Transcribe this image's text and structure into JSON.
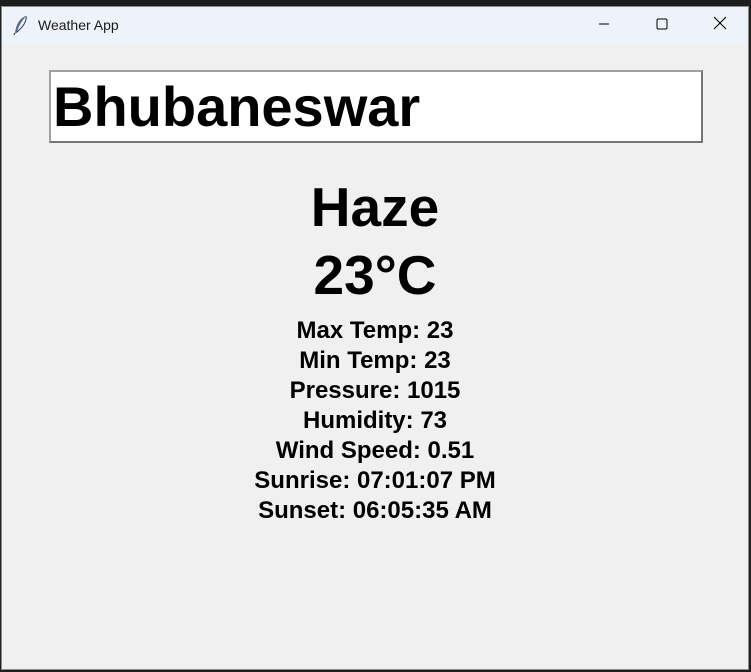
{
  "window": {
    "title": "Weather App",
    "icon": "feather-icon"
  },
  "controls": {
    "minimize_icon": "minimize-icon",
    "maximize_icon": "maximize-icon",
    "close_icon": "close-icon"
  },
  "search": {
    "city_value": "Bhubaneswar"
  },
  "weather": {
    "condition": "Haze",
    "temperature": "23°C",
    "details": [
      "Max Temp: 23",
      "Min Temp: 23",
      "Pressure: 1015",
      "Humidity: 73",
      "Wind Speed: 0.51",
      "Sunrise: 07:01:07 PM",
      "Sunset: 06:05:35 AM"
    ]
  },
  "colors": {
    "background": "#f0f0f0",
    "titlebar": "#eef3f9",
    "entry_background": "#ffffff",
    "text": "#000000"
  }
}
